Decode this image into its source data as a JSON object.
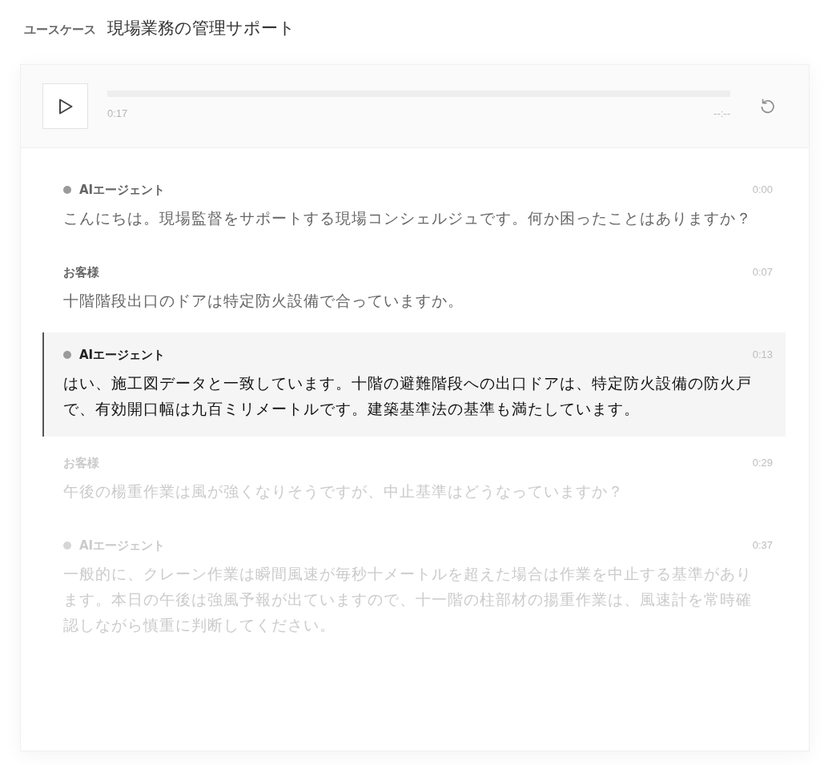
{
  "header": {
    "label": "ユースケース",
    "title": "現場業務の管理サポート"
  },
  "player": {
    "current_time": "0:17",
    "duration": "--:--"
  },
  "messages": [
    {
      "kind": "agent",
      "speaker": "AIエージェント",
      "time": "0:00",
      "text": "こんにちは。現場監督をサポートする現場コンシェルジュです。何か困ったことはありますか？",
      "active": false,
      "played": true
    },
    {
      "kind": "customer",
      "speaker": "お客様",
      "time": "0:07",
      "text": "十階階段出口のドアは特定防火設備で合っていますか。",
      "active": false,
      "played": true
    },
    {
      "kind": "agent",
      "speaker": "AIエージェント",
      "time": "0:13",
      "text": "はい、施工図データと一致しています。十階の避難階段への出口ドアは、特定防火設備の防火戸で、有効開口幅は九百ミリメートルです。建築基準法の基準も満たしています。",
      "active": true,
      "played": true
    },
    {
      "kind": "customer",
      "speaker": "お客様",
      "time": "0:29",
      "text": "午後の楊重作業は風が強くなりそうですが、中止基準はどうなっていますか？",
      "active": false,
      "played": false
    },
    {
      "kind": "agent",
      "speaker": "AIエージェント",
      "time": "0:37",
      "text": "一般的に、クレーン作業は瞬間風速が毎秒十メートルを超えた場合は作業を中止する基準があります。本日の午後は強風予報が出ていますので、十一階の柱部材の揚重作業は、風速計を常時確認しながら慎重に判断してください。",
      "active": false,
      "played": false
    }
  ]
}
